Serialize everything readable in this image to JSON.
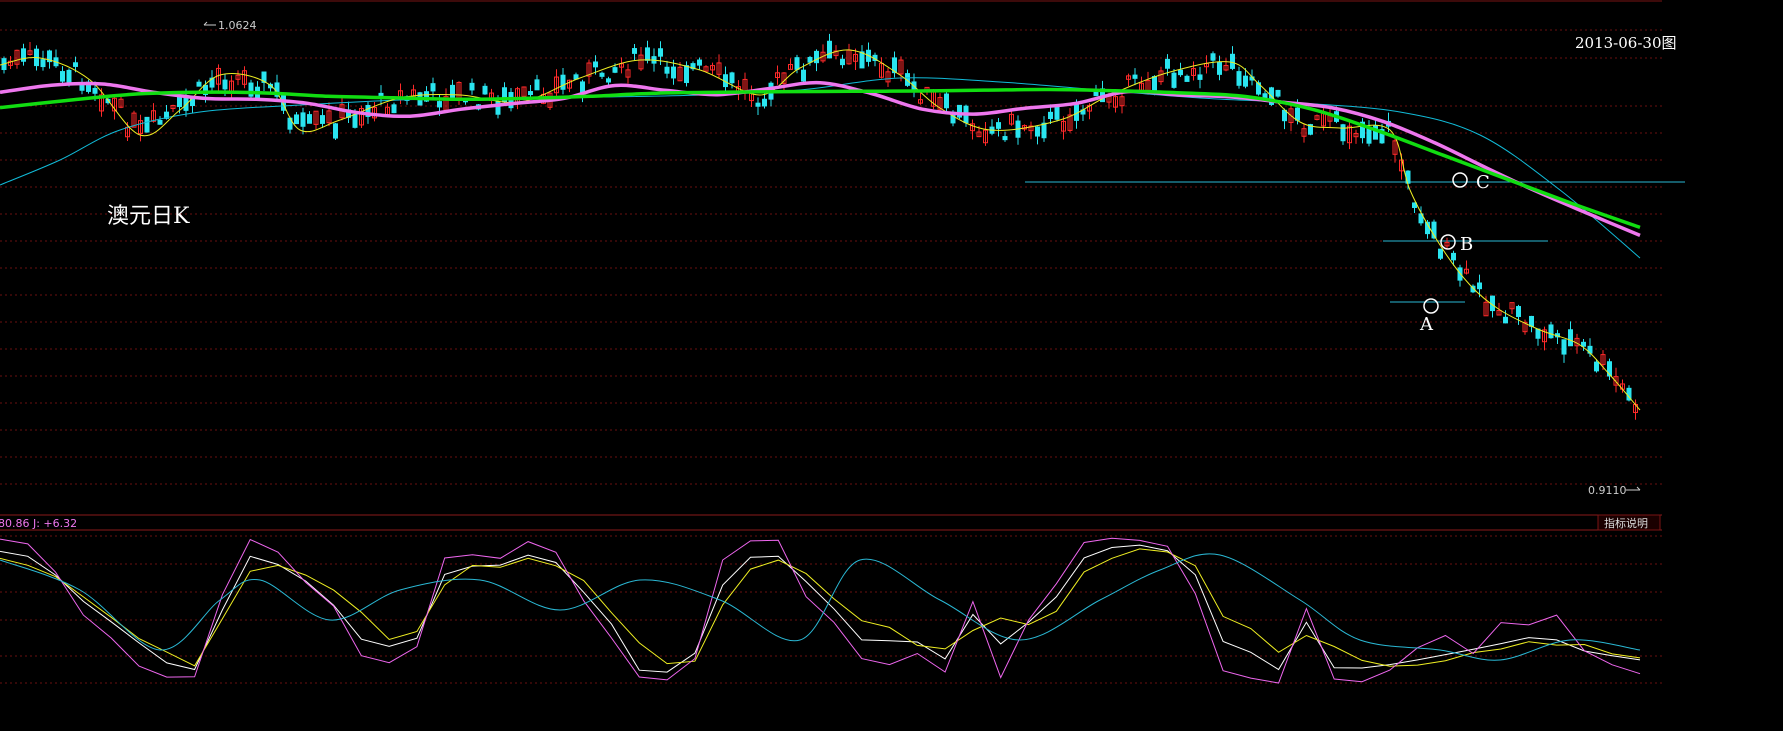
{
  "chart_data": {
    "type": "line",
    "title": "澳元日K",
    "date_label": "2013-06-30图",
    "price": {
      "high_label": "1.0624",
      "low_label": "0.9110",
      "ma_slow": [
        1.0355,
        1.0378,
        1.0398,
        1.0405,
        1.0403,
        1.0392,
        1.0387,
        1.0382,
        1.0385,
        1.0392,
        1.0402,
        1.0405,
        1.0407,
        1.0408,
        1.0409,
        1.0412,
        1.0414,
        1.041,
        1.0403,
        1.0391,
        1.035,
        1.028,
        1.02,
        1.012,
        1.004,
        0.9965
      ],
      "ma_mid": [
        1.0405,
        1.0428,
        1.0432,
        1.0405,
        1.0385,
        1.0382,
        1.0369,
        1.0338,
        1.0327,
        1.035,
        1.0368,
        1.0385,
        1.0427,
        1.0411,
        1.0397,
        1.0417,
        1.0436,
        1.0401,
        1.035,
        1.0334,
        1.0353,
        1.0369,
        1.0407,
        1.0396,
        1.039,
        1.0373,
        1.0354,
        1.0309,
        1.024,
        1.0159,
        1.0081,
        1.0009,
        0.9939
      ]
    },
    "series": [
      {
        "name": "K",
        "values": [
          89.5,
          86.2,
          73.4,
          55.5,
          41.6,
          27.3,
          13.7,
          9.2,
          49.7,
          86.2,
          80.6,
          69.3,
          52.9,
          29.8,
          24.9,
          30.5,
          73.9,
          79.5,
          80.2,
          87.0,
          82.0,
          61.7,
          40.1,
          8.7,
          7.4,
          20.3,
          66.7,
          85.5,
          86.2,
          69.0,
          50.5,
          29.3,
          28.7,
          27.9,
          16.4,
          46.6,
          26.6,
          41.3,
          58.6,
          85.1,
          92.2,
          93.8,
          90.0,
          73.6,
          28.2,
          20.9,
          9.2,
          41.3,
          10.4,
          10.2,
          12.5,
          15.7,
          19.3,
          23.0,
          26.8,
          30.9,
          29.3,
          21.8,
          18.6,
          15.7
        ]
      },
      {
        "name": "D",
        "values": [
          84.8,
          80.1,
          72.3,
          58.6,
          44.7,
          30.2,
          21.0,
          11.7,
          43.7,
          76.0,
          80.0,
          73.4,
          63.2,
          48.1,
          29.6,
          35.0,
          66.8,
          80.0,
          78.7,
          84.8,
          79.7,
          69.7,
          47.8,
          27.3,
          13.2,
          14.8,
          53.2,
          77.5,
          83.6,
          74.4,
          57.3,
          42.4,
          37.8,
          25.6,
          23.2,
          35.7,
          44.2,
          39.7,
          48.8,
          75.6,
          84.8,
          91.2,
          89.1,
          79.8,
          45.3,
          37.1,
          20.9,
          32.3,
          24.8,
          15.4,
          11.4,
          12.2,
          15.2,
          20.7,
          23.1,
          28.1,
          25.8,
          26.2,
          19.8,
          17.1
        ]
      },
      {
        "name": "J",
        "values": [
          97.9,
          94.6,
          75.4,
          46.2,
          30.6,
          11.5,
          4.0,
          4.2,
          60.1,
          97.6,
          89.0,
          68.4,
          52.3,
          18.6,
          13.8,
          24.7,
          85.0,
          87.2,
          84.8,
          96.2,
          88.9,
          55.9,
          30.6,
          4.1,
          2.1,
          16.6,
          83.7,
          96.7,
          97.1,
          58.7,
          41.3,
          16.6,
          12.5,
          20.1,
          7.5,
          55.4,
          3.7,
          42.7,
          67.5,
          95.6,
          98.5,
          97.0,
          93.0,
          60.8,
          8.4,
          3.3,
          0.0,
          50.6,
          2.7,
          0.9,
          8.8,
          24.0,
          32.3,
          20.1,
          41.1,
          39.5,
          46.2,
          21.9,
          12.4,
          6.32
        ]
      }
    ],
    "annotations": [
      "A",
      "B",
      "C"
    ]
  },
  "kdj": {
    "header": "80.86 J: +6.32",
    "button_label": "指标说明"
  },
  "colors": {
    "up": "#ff2a2a",
    "down": "#2ae5f0",
    "ma_slow": "#11dd11",
    "ma_mid": "#ee77ee",
    "ma_fast": "#eeee22",
    "ma_long": "#11bbd8",
    "k": "#ffffff",
    "d": "#eeee22",
    "j": "#ee66ee",
    "grid": "#6a1010"
  }
}
